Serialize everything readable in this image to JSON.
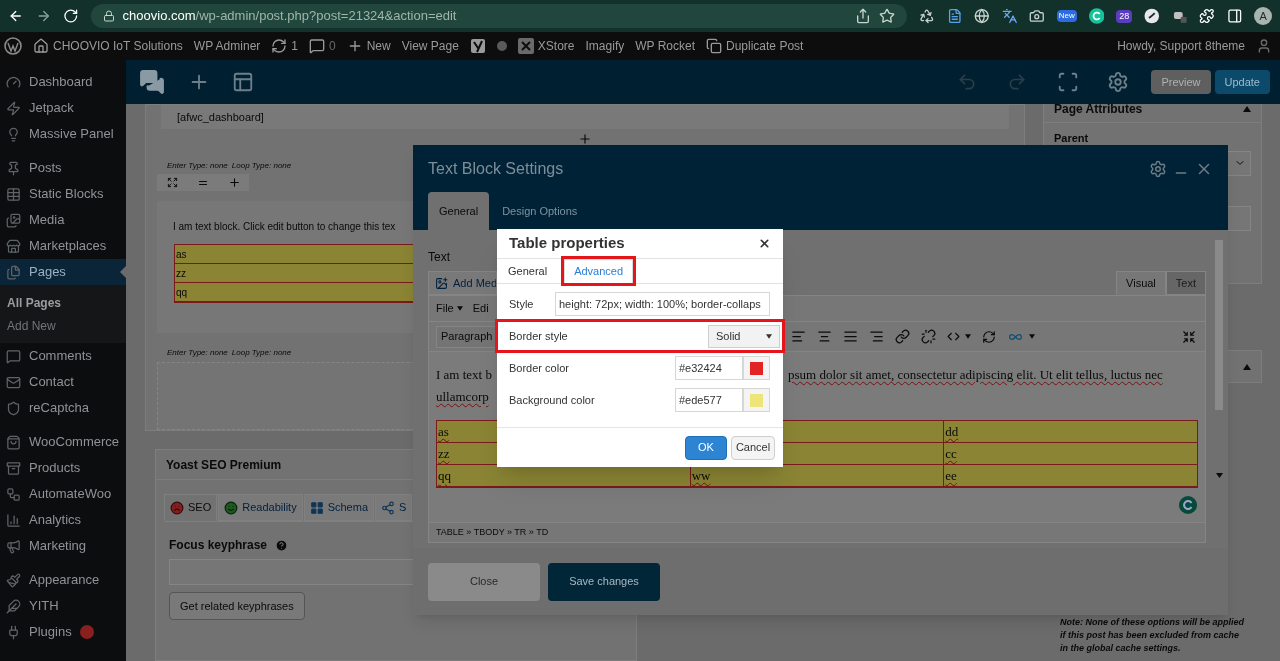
{
  "browser": {
    "url_host": "choovio.com",
    "url_path": "/wp-admin/post.php?post=21324&action=edit",
    "extension_badges": [
      "New",
      "28"
    ],
    "profile_initial": "A"
  },
  "admin_bar": {
    "items": [
      {
        "kind": "wp-logo"
      },
      {
        "kind": "home",
        "label": "CHOOVIO IoT Solutions"
      },
      {
        "kind": "text",
        "label": "WP Adminer"
      },
      {
        "kind": "updates",
        "label": "1"
      },
      {
        "kind": "comments",
        "label": "0"
      },
      {
        "kind": "new",
        "label": "New"
      },
      {
        "kind": "text",
        "label": "View Page"
      },
      {
        "kind": "yoast"
      },
      {
        "kind": "dot"
      },
      {
        "kind": "xstore",
        "label": "XStore"
      },
      {
        "kind": "text",
        "label": "Imagify"
      },
      {
        "kind": "text",
        "label": "WP Rocket"
      },
      {
        "kind": "duplicate",
        "label": "Duplicate Post"
      }
    ],
    "greeting": "Howdy, Support 8theme"
  },
  "sidebar": {
    "groups": [
      [
        {
          "label": "Dashboard",
          "selected": false
        },
        {
          "label": "Jetpack",
          "selected": false
        },
        {
          "label": "Massive Panel",
          "selected": false
        }
      ],
      [
        {
          "label": "Posts",
          "selected": false
        },
        {
          "label": "Static Blocks",
          "selected": false
        },
        {
          "label": "Media",
          "selected": false
        },
        {
          "label": "Marketplaces",
          "selected": false
        },
        {
          "label": "Pages",
          "selected": true,
          "children": [
            {
              "label": "All Pages",
              "selected": true
            },
            {
              "label": "Add New",
              "selected": false
            }
          ]
        },
        {
          "label": "Comments",
          "selected": false
        },
        {
          "label": "Contact",
          "selected": false
        },
        {
          "label": "reCaptcha",
          "selected": false
        }
      ],
      [
        {
          "label": "WooCommerce",
          "selected": false
        },
        {
          "label": "Products",
          "selected": false
        },
        {
          "label": "AutomateWoo",
          "selected": false
        },
        {
          "label": "Analytics",
          "selected": false
        },
        {
          "label": "Marketing",
          "selected": false
        }
      ],
      [
        {
          "label": "Appearance",
          "selected": false
        },
        {
          "label": "YITH",
          "selected": false
        },
        {
          "label": "Plugins",
          "selected": false,
          "badge": true
        }
      ]
    ]
  },
  "toolbar": {
    "buttons": [
      {
        "label": "Preview",
        "kind": "secondary"
      },
      {
        "label": "Update",
        "kind": "primary"
      }
    ]
  },
  "builder": {
    "shortcode": "[afwc_dashboard]",
    "rows": [
      {
        "meta": [
          "Enter Type: none",
          "Loop Type: none"
        ],
        "text": "I am text block. Click edit button to change this tex",
        "table": [
          "as",
          "zz",
          "qq"
        ]
      },
      {
        "meta": [
          "Enter Type: none",
          "Loop Type: none"
        ]
      }
    ]
  },
  "yoast": {
    "title": "Yoast SEO Premium",
    "tabs": [
      {
        "label": "SEO",
        "selected": true
      },
      {
        "label": "Readability",
        "selected": false
      },
      {
        "label": "Schema",
        "selected": false
      },
      {
        "label": "S",
        "selected": false
      }
    ],
    "focus_label": "Focus keyphrase",
    "button": "Get related keyphrases"
  },
  "right_panel": {
    "title": "Page Attributes",
    "parent_label": "Parent",
    "note": "Note: None of these options will be applied if this post has been excluded from cache in the global cache settings."
  },
  "text_block_settings": {
    "title": "Text Block Settings",
    "tabs": [
      {
        "label": "General",
        "selected": true
      },
      {
        "label": "Design Options",
        "selected": false
      }
    ],
    "section_label": "Text",
    "add_media": "Add Med",
    "editor_tabs": [
      {
        "label": "Visual",
        "selected": true
      },
      {
        "label": "Text",
        "selected": false
      }
    ],
    "menus": [
      {
        "label": "File",
        "has_caret": true
      },
      {
        "label": "Edi",
        "has_caret": false
      }
    ],
    "format_select": "Paragraph",
    "content_left": [
      "I am text b",
      "ullamcorp"
    ],
    "content_right": "psum dolor sit amet, consectetur adipiscing elit. Ut elit tellus, luctus nec",
    "table_rows": [
      [
        "as",
        null,
        "dd"
      ],
      [
        "zz",
        null,
        "cc"
      ],
      [
        "qq",
        "ww",
        "ee"
      ]
    ],
    "breadcrumb": "TABLE » TBODY » TR » TD",
    "buttons": [
      {
        "label": "Close",
        "kind": "secondary"
      },
      {
        "label": "Save changes",
        "kind": "primary"
      }
    ]
  },
  "table_properties": {
    "title": "Table properties",
    "tabs": [
      {
        "label": "General",
        "selected": false,
        "highlighted": false
      },
      {
        "label": "Advanced",
        "selected": true,
        "highlighted": true
      }
    ],
    "fields": [
      {
        "kind": "text",
        "label": "Style",
        "value": "height: 72px; width: 100%; border-collaps",
        "highlighted": false
      },
      {
        "kind": "select",
        "label": "Border style",
        "value": "Solid",
        "highlighted": true
      },
      {
        "kind": "color",
        "label": "Border color",
        "value": "#e32424",
        "color": "#e32424",
        "highlighted": false
      },
      {
        "kind": "color",
        "label": "Background color",
        "value": "#ede577",
        "color": "#ede577",
        "highlighted": false
      }
    ],
    "buttons": [
      {
        "label": "OK",
        "kind": "primary"
      },
      {
        "label": "Cancel",
        "kind": "secondary"
      }
    ]
  }
}
